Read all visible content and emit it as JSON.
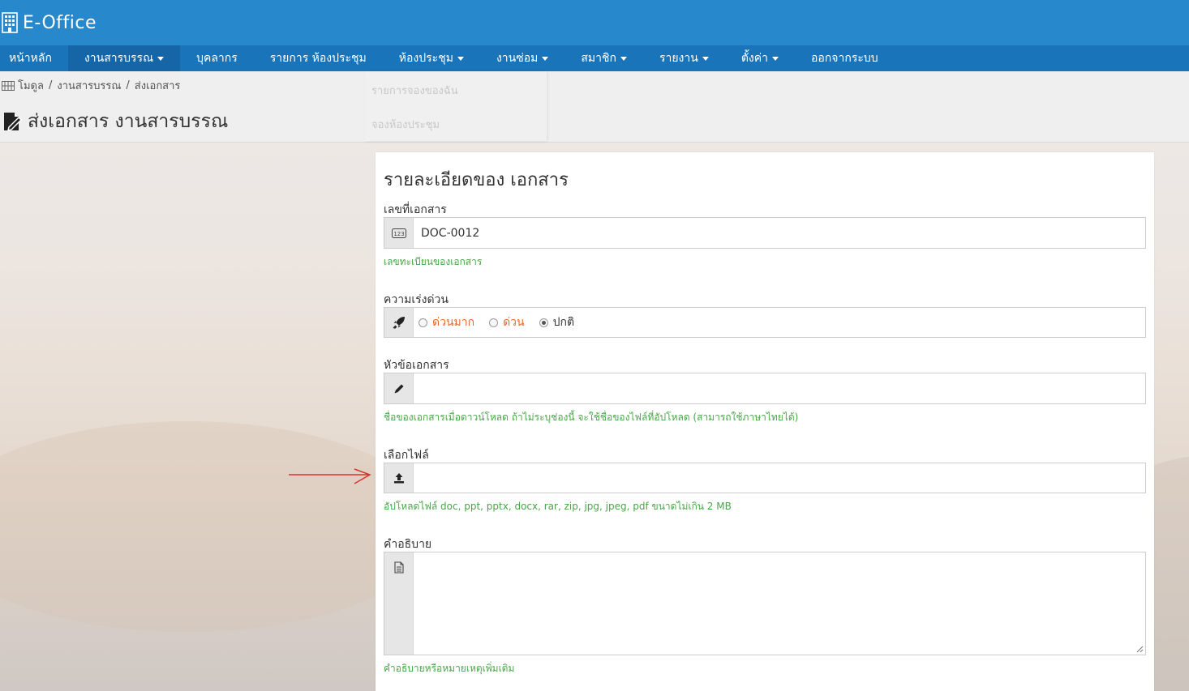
{
  "app": {
    "title": "E-Office"
  },
  "nav": [
    {
      "label": "หน้าหลัก",
      "dropdown": false,
      "active": false
    },
    {
      "label": "งานสารบรรณ",
      "dropdown": true,
      "active": true
    },
    {
      "label": "บุคลากร",
      "dropdown": false,
      "active": false
    },
    {
      "label": "รายการ ห้องประชุม",
      "dropdown": false,
      "active": false
    },
    {
      "label": "ห้องประชุม",
      "dropdown": true,
      "active": false
    },
    {
      "label": "งานซ่อม",
      "dropdown": true,
      "active": false
    },
    {
      "label": "สมาชิก",
      "dropdown": true,
      "active": false
    },
    {
      "label": "รายงาน",
      "dropdown": true,
      "active": false
    },
    {
      "label": "ตั้งค่า",
      "dropdown": true,
      "active": false
    },
    {
      "label": "ออกจากระบบ",
      "dropdown": false,
      "active": false
    }
  ],
  "dropdown_menu": {
    "items": [
      "รายการจองของฉัน",
      "จองห้องประชุม"
    ]
  },
  "breadcrumb": [
    "โมดูล",
    "งานสารบรรณ",
    "ส่งเอกสาร"
  ],
  "page_title": "ส่งเอกสาร งานสารบรรณ",
  "form": {
    "title": "รายละเอียดของ เอกสาร",
    "doc_no": {
      "label": "เลขที่เอกสาร",
      "value": "DOC-0012",
      "hint": "เลขทะเบียนของเอกสาร",
      "icon": "number-icon"
    },
    "urgency": {
      "label": "ความเร่งด่วน",
      "icon": "rocket-icon",
      "options": [
        {
          "label": "ด่วนมาก",
          "color": "#e8692e",
          "checked": false
        },
        {
          "label": "ด่วน",
          "color": "#e8692e",
          "checked": false
        },
        {
          "label": "ปกติ",
          "color": "#333333",
          "checked": true
        }
      ]
    },
    "subject": {
      "label": "หัวข้อเอกสาร",
      "value": "",
      "hint": "ชื่อของเอกสารเมื่อดาวน์โหลด ถ้าไม่ระบุช่องนี้ จะใช้ชื่อของไฟล์ที่อัปโหลด (สามารถใช้ภาษาไทยได้)",
      "icon": "pencil-icon"
    },
    "file": {
      "label": "เลือกไฟล์",
      "value": "",
      "hint": "อัปโหลดไฟล์ doc, ppt, pptx, docx, rar, zip, jpg, jpeg, pdf ขนาดไม่เกิน 2 MB",
      "icon": "upload-icon"
    },
    "description": {
      "label": "คำอธิบาย",
      "value": "",
      "hint": "คำอธิบายหรือหมายเหตุเพิ่มเติม",
      "icon": "document-icon"
    }
  },
  "colors": {
    "header": "#2788cc",
    "navbar": "#1a74b9",
    "hint": "#4aa54a",
    "urgent": "#e8692e",
    "arrow": "#d9342b"
  }
}
